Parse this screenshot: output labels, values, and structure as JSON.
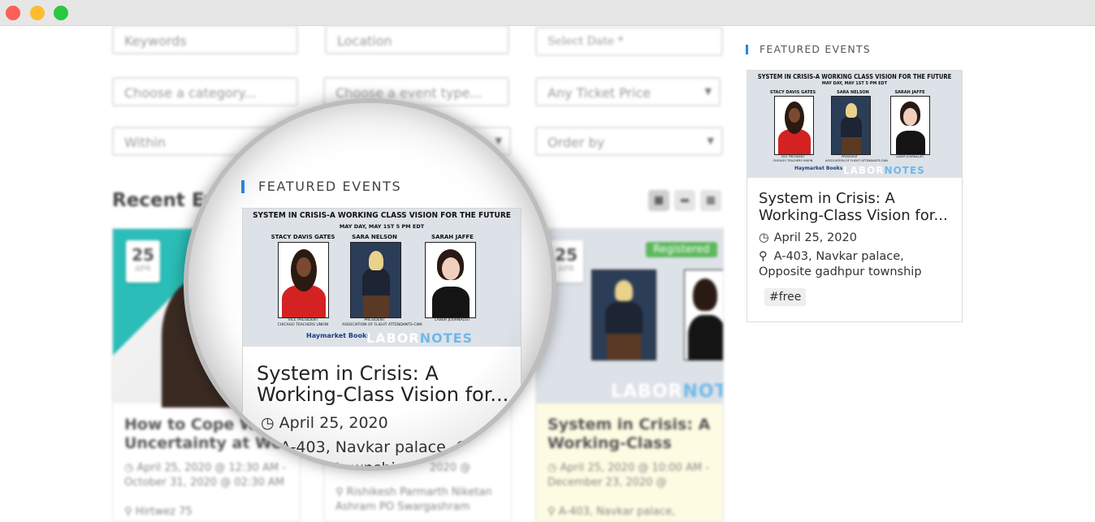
{
  "window": {
    "controls": [
      "close",
      "minimize",
      "maximize"
    ]
  },
  "filters": {
    "keywords_placeholder": "Keywords",
    "location_placeholder": "Location",
    "date_placeholder": "Select Date *",
    "category_placeholder": "Choose a category...",
    "event_type_placeholder": "Choose a event type...",
    "ticket_price_value": "Any Ticket Price",
    "within_value": "Within",
    "order_by_value": "Order by"
  },
  "recent_events": {
    "heading": "Recent Ev",
    "cards": [
      {
        "day": "25",
        "month": "APR",
        "title": "How to Cope W Uncertainty at Wo",
        "date": "April 25, 2020 @ 12:30 AM - October 31, 2020 @ 02:30 AM",
        "location": "Hirtwez 75"
      },
      {
        "title": "",
        "date": "2020 @",
        "location": "Rishikesh Parmarth Niketan Ashram PO Swargashram"
      },
      {
        "day": "25",
        "month": "APR",
        "badge": "Registered",
        "title": "System in Crisis: A Working-Class",
        "date": "April 25, 2020 @ 10:00 AM - December 23, 2020 @",
        "location": "A-403, Navkar palace,"
      }
    ]
  },
  "poster": {
    "headline": "SYSTEM IN CRISIS-A WORKING CLASS VISION FOR THE FUTURE",
    "subline": "MAY DAY, MAY 1ST 5 PM EDT",
    "speakers": [
      {
        "name": "STACY DAVIS GATES",
        "role": "VICE PRESIDENT",
        "org": "CHICAGO TEACHERS UNION"
      },
      {
        "name": "SARA NELSON",
        "role": "PRESIDENT",
        "org": "ASSOCIATION OF FLIGHT ATTENDANTS-CWA"
      },
      {
        "name": "SARAH JAFFE",
        "role": "LABOR JOURNALIST",
        "org": ""
      }
    ],
    "logo_left": "Haymarket Books",
    "logo_right_a": "LABOR",
    "logo_right_b": "NOTES"
  },
  "featured": {
    "heading": "FEATURED EVENTS",
    "title": "System in Crisis: A Working-Class Vision for...",
    "date": "April 25, 2020",
    "location": "A-403, Navkar palace, Opposite gadhpur township",
    "tag": "#free"
  },
  "magnifier": {
    "heading": "FEATURED EVENTS",
    "title": "System in Crisis: A Working-Class Vision for...",
    "date": "April 25, 2020",
    "location_partial": "A-403, Navkar palace, Opp",
    "location_partial_2": "r township"
  },
  "colors": {
    "accent": "#1e88e5",
    "registered": "#5cb85c",
    "poster_bg": "#dde2e8"
  }
}
